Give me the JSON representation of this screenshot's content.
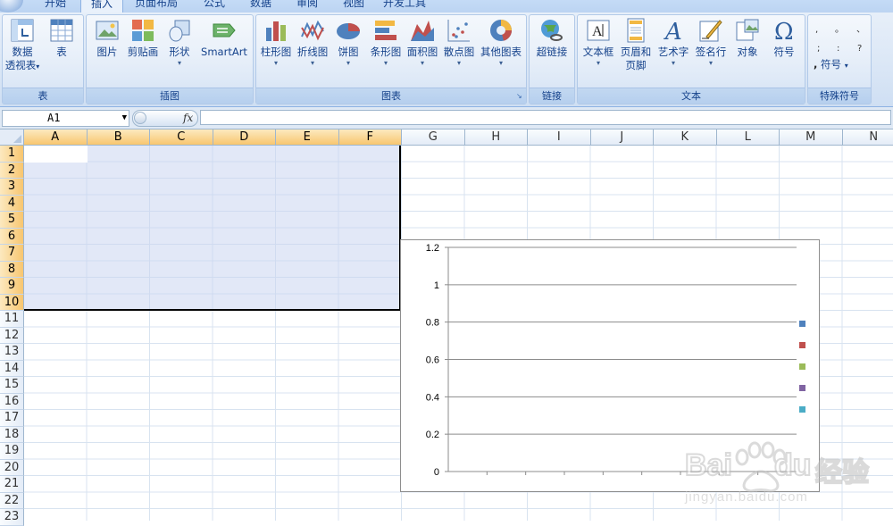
{
  "tabs": [
    "开始",
    "插入",
    "页面布局",
    "公式",
    "数据",
    "审阅",
    "视图",
    "开发工具"
  ],
  "active_tab": "插入",
  "ribbon": {
    "groups": {
      "table": {
        "title": "表",
        "pivot_label_1": "数据",
        "pivot_label_2": "透视表",
        "table_label": "表"
      },
      "illustrations": {
        "title": "插图",
        "picture": "图片",
        "clipart": "剪贴画",
        "shapes": "形状",
        "smartart": "SmartArt"
      },
      "charts": {
        "title": "图表",
        "column": "柱形图",
        "line": "折线图",
        "pie": "饼图",
        "bar": "条形图",
        "area": "面积图",
        "scatter": "散点图",
        "other": "其他图表"
      },
      "links": {
        "title": "链接",
        "hyperlink": "超链接"
      },
      "text": {
        "title": "文本",
        "textbox": "文本框",
        "headerfooter_1": "页眉和",
        "headerfooter_2": "页脚",
        "wordart": "艺术字",
        "signature": "签名行",
        "object": "对象",
        "symbol": "符号"
      },
      "special": {
        "title": "特殊符号",
        "symbol": "符号",
        "dropdown_glyph": "▾"
      }
    },
    "arrow_glyph": "▾",
    "launcher_glyph": "↘"
  },
  "formula_bar": {
    "name_box": "A1",
    "dropdown_glyph": "▼",
    "fx_label": "fx",
    "formula": ""
  },
  "grid": {
    "columns": [
      "A",
      "B",
      "C",
      "D",
      "E",
      "F",
      "G",
      "H",
      "I",
      "J",
      "K",
      "L",
      "M",
      "N"
    ],
    "rows": [
      "1",
      "2",
      "3",
      "4",
      "5",
      "6",
      "7",
      "8",
      "9",
      "10",
      "11",
      "12",
      "13",
      "14",
      "15",
      "16",
      "17",
      "18",
      "19",
      "20",
      "21",
      "22",
      "23"
    ],
    "selected_range": "A1:F10"
  },
  "chart_data": {
    "type": "bar",
    "categories": [],
    "series": [
      {
        "values": [],
        "color": "#4f81bd"
      },
      {
        "values": [],
        "color": "#c0504d"
      },
      {
        "values": [],
        "color": "#9bbb59"
      },
      {
        "values": [],
        "color": "#8064a2"
      },
      {
        "values": [],
        "color": "#4bacc6"
      }
    ],
    "yticks": [
      "1.2",
      "1",
      "0.8",
      "0.6",
      "0.4",
      "0.2",
      "0"
    ],
    "ylim": [
      0,
      1.2
    ],
    "grid": true,
    "legend": "right",
    "title": ""
  },
  "watermark": {
    "brand": "Bai",
    "brand_2": "du",
    "cn": "经验",
    "url": "jingyan.baidu.com"
  }
}
